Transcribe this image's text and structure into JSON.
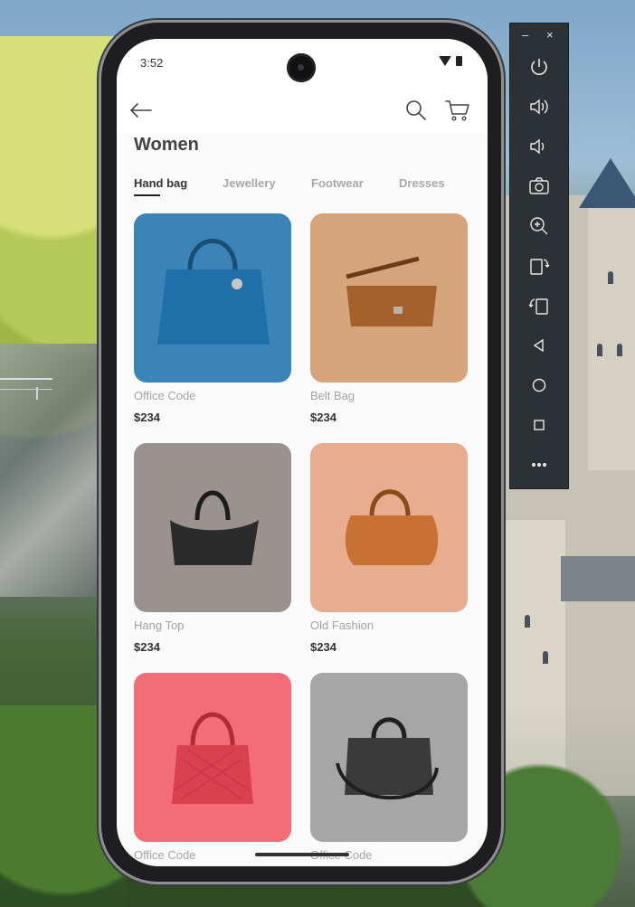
{
  "status_bar": {
    "time": "3:52"
  },
  "app_bar": {
    "back_icon": "arrow-left-icon",
    "search_icon": "search-icon",
    "cart_icon": "cart-icon"
  },
  "page": {
    "title": "Women"
  },
  "tabs": [
    {
      "label": "Hand bag",
      "active": true
    },
    {
      "label": "Jewellery",
      "active": false
    },
    {
      "label": "Footwear",
      "active": false
    },
    {
      "label": "Dresses",
      "active": false
    }
  ],
  "products": [
    {
      "name": "Office Code",
      "price": "$234",
      "bg_color": "#3b84b8",
      "bag_color": "#1f6fa8"
    },
    {
      "name": "Belt Bag",
      "price": "$234",
      "bg_color": "#d6a47a",
      "bag_color": "#a5612b"
    },
    {
      "name": "Hang Top",
      "price": "$234",
      "bg_color": "#99928f",
      "bag_color": "#2b2b2b"
    },
    {
      "name": "Old Fashion",
      "price": "$234",
      "bg_color": "#e8ad8e",
      "bag_color": "#c97035"
    },
    {
      "name": "Office Code",
      "price": "",
      "bg_color": "#f26d78",
      "bag_color": "#d94050"
    },
    {
      "name": "Office Code",
      "price": "",
      "bg_color": "#a6a6a6",
      "bag_color": "#3a3a3a"
    }
  ],
  "emulator_toolbar": {
    "minimize_label": "–",
    "close_label": "×",
    "buttons": [
      "power-icon",
      "volume-up-icon",
      "volume-down-icon",
      "camera-icon",
      "zoom-icon",
      "rotate-left-icon",
      "rotate-right-icon",
      "back-triangle-icon",
      "home-circle-icon",
      "overview-square-icon",
      "more-icon"
    ]
  },
  "colors": {
    "accent": "#222222",
    "tab_inactive": "#a9a9a9",
    "toolbar_bg": "#2c3136"
  }
}
